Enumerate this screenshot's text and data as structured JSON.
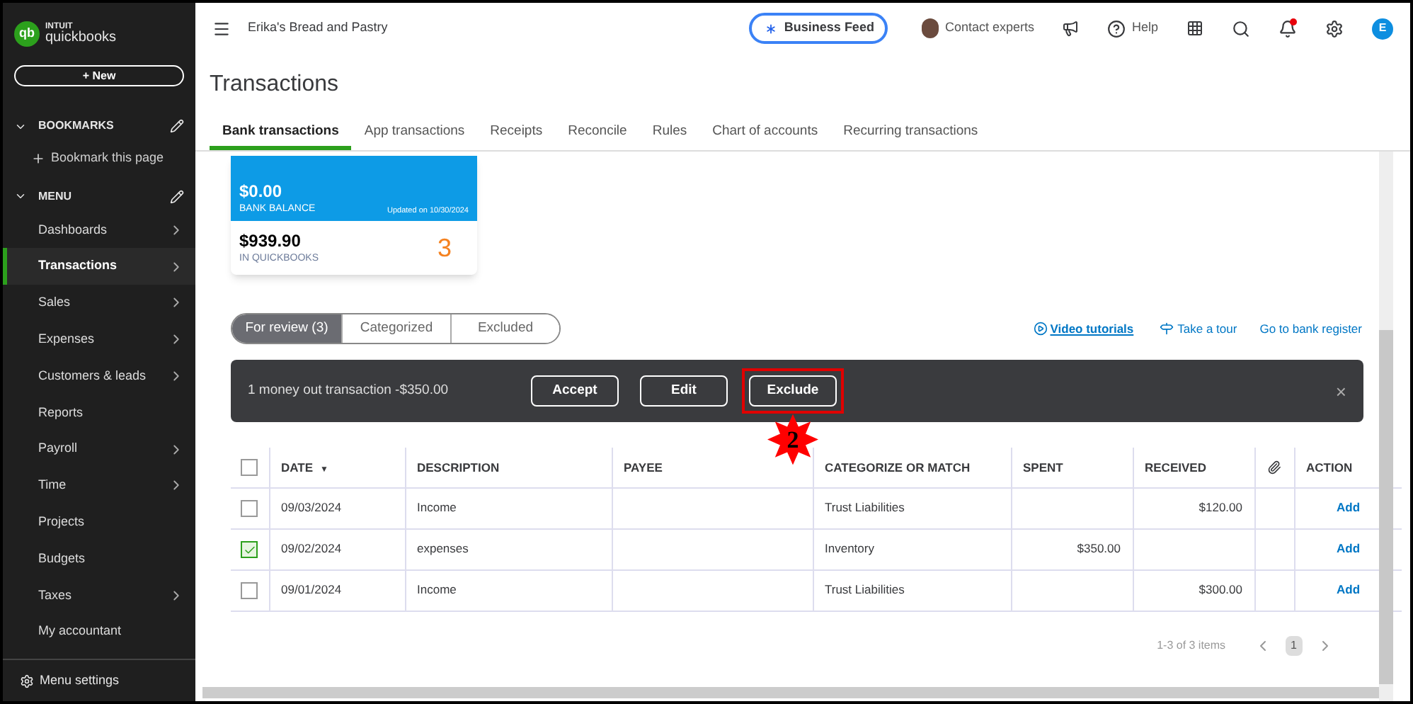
{
  "sidebar": {
    "logo": {
      "brand_top": "INTUIT",
      "brand": "quickbooks",
      "mark": "qb"
    },
    "new_button": "+ New",
    "bookmarks": {
      "label": "BOOKMARKS",
      "expanded": true,
      "add": "Bookmark this page"
    },
    "menu": {
      "label": "MENU",
      "expanded": true
    },
    "items": [
      {
        "label": "Dashboards",
        "selected": false,
        "has_submenu": true
      },
      {
        "label": "Transactions",
        "selected": true,
        "has_submenu": true
      },
      {
        "label": "Sales",
        "selected": false,
        "has_submenu": true
      },
      {
        "label": "Expenses",
        "selected": false,
        "has_submenu": true
      },
      {
        "label": "Customers & leads",
        "selected": false,
        "has_submenu": true
      },
      {
        "label": "Reports",
        "selected": false,
        "has_submenu": false
      },
      {
        "label": "Payroll",
        "selected": false,
        "has_submenu": true
      },
      {
        "label": "Time",
        "selected": false,
        "has_submenu": true
      },
      {
        "label": "Projects",
        "selected": false,
        "has_submenu": false
      },
      {
        "label": "Budgets",
        "selected": false,
        "has_submenu": false
      },
      {
        "label": "Taxes",
        "selected": false,
        "has_submenu": true
      },
      {
        "label": "My accountant",
        "selected": false,
        "has_submenu": false
      }
    ],
    "settings": "Menu settings"
  },
  "header": {
    "company": "Erika's Bread and Pastry",
    "business_feed": "Business Feed",
    "contact": "Contact experts",
    "help": "Help",
    "avatar": "E",
    "notification": true
  },
  "page_title": "Transactions",
  "tabs": [
    {
      "label": "Bank transactions",
      "selected": true
    },
    {
      "label": "App transactions",
      "selected": false
    },
    {
      "label": "Receipts",
      "selected": false
    },
    {
      "label": "Reconcile",
      "selected": false
    },
    {
      "label": "Rules",
      "selected": false
    },
    {
      "label": "Chart of accounts",
      "selected": false
    },
    {
      "label": "Recurring transactions",
      "selected": false
    }
  ],
  "bank_card": {
    "bank_balance": "$0.00",
    "bank_balance_label": "BANK BALANCE",
    "updated": "Updated on 10/30/2024",
    "qb_balance": "$939.90",
    "qb_label": "IN QUICKBOOKS",
    "count": "3"
  },
  "filters": [
    {
      "label": "For review (3)",
      "selected": true
    },
    {
      "label": "Categorized",
      "selected": false
    },
    {
      "label": "Excluded",
      "selected": false
    }
  ],
  "links": {
    "video": "Video tutorials",
    "tour": "Take a tour",
    "register": "Go to bank register"
  },
  "batch_bar": {
    "summary": "1 money out transaction -$350.00",
    "buttons": [
      {
        "label": "Accept",
        "highlighted": false
      },
      {
        "label": "Edit",
        "highlighted": false
      },
      {
        "label": "Exclude",
        "highlighted": true
      }
    ],
    "close": "×"
  },
  "annotation": {
    "label": "2"
  },
  "table": {
    "select_all_checked": false,
    "columns": [
      "DATE",
      "DESCRIPTION",
      "PAYEE",
      "CATEGORIZE OR MATCH",
      "SPENT",
      "RECEIVED",
      "ACTION"
    ],
    "sort_mark": "▼",
    "rows": [
      {
        "checked": false,
        "date": "09/03/2024",
        "description": "Income",
        "category": "Trust Liabilities",
        "spent": "",
        "received": "$120.00",
        "action": "Add"
      },
      {
        "checked": true,
        "date": "09/02/2024",
        "description": "expenses",
        "category": "Inventory",
        "spent": "$350.00",
        "received": "",
        "action": "Add"
      },
      {
        "checked": false,
        "date": "09/01/2024",
        "description": "Income",
        "category": "Trust Liabilities",
        "spent": "",
        "received": "$300.00",
        "action": "Add"
      }
    ]
  },
  "pagination": {
    "summary": "1-3 of 3 items",
    "page": "1"
  }
}
